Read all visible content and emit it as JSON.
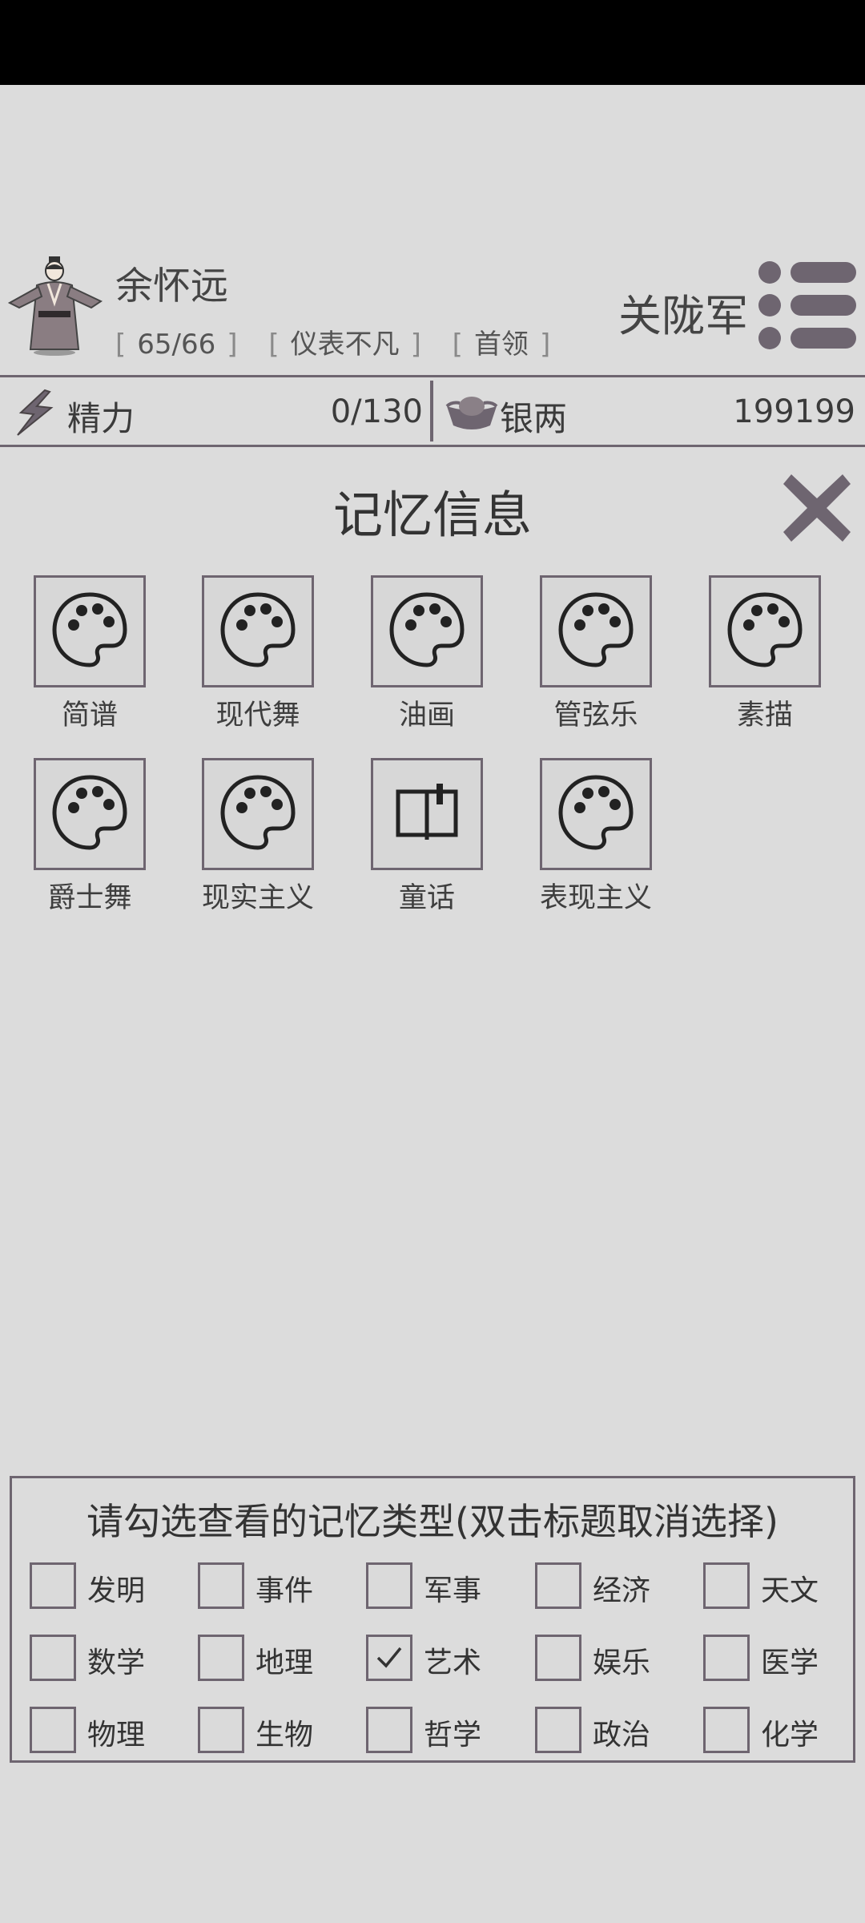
{
  "player": {
    "name": "余怀远",
    "tags": [
      "65/66",
      "仪表不凡",
      "首领"
    ],
    "rank": "关陇军"
  },
  "stats": {
    "energy": {
      "label": "精力",
      "value": "0/130"
    },
    "silver": {
      "label": "银两",
      "value": "199199"
    }
  },
  "memory": {
    "title": "记忆信息",
    "items": [
      {
        "label": "简谱",
        "icon": "palette-icon"
      },
      {
        "label": "现代舞",
        "icon": "palette-icon"
      },
      {
        "label": "油画",
        "icon": "palette-icon"
      },
      {
        "label": "管弦乐",
        "icon": "palette-icon"
      },
      {
        "label": "素描",
        "icon": "palette-icon"
      },
      {
        "label": "爵士舞",
        "icon": "palette-icon"
      },
      {
        "label": "现实主义",
        "icon": "palette-icon"
      },
      {
        "label": "童话",
        "icon": "book-icon"
      },
      {
        "label": "表现主义",
        "icon": "palette-icon"
      }
    ]
  },
  "filter": {
    "title": "请勾选查看的记忆类型(双击标题取消选择)",
    "options": [
      {
        "label": "发明",
        "checked": false
      },
      {
        "label": "事件",
        "checked": false
      },
      {
        "label": "军事",
        "checked": false
      },
      {
        "label": "经济",
        "checked": false
      },
      {
        "label": "天文",
        "checked": false
      },
      {
        "label": "数学",
        "checked": false
      },
      {
        "label": "地理",
        "checked": false
      },
      {
        "label": "艺术",
        "checked": true
      },
      {
        "label": "娱乐",
        "checked": false
      },
      {
        "label": "医学",
        "checked": false
      },
      {
        "label": "物理",
        "checked": false
      },
      {
        "label": "生物",
        "checked": false
      },
      {
        "label": "哲学",
        "checked": false
      },
      {
        "label": "政治",
        "checked": false
      },
      {
        "label": "化学",
        "checked": false
      }
    ]
  },
  "colors": {
    "background": "#dcdcdc",
    "border": "#6e6570",
    "text": "#3b3b3b"
  }
}
